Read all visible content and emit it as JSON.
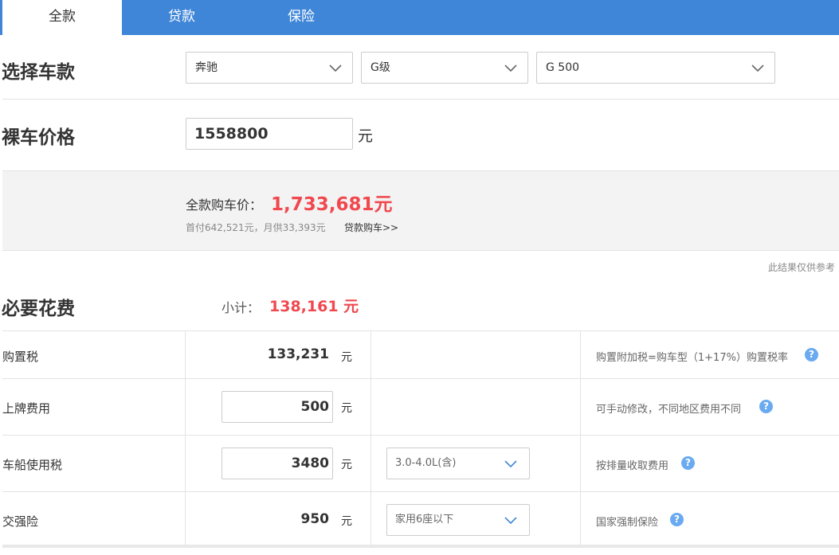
{
  "tabs": [
    {
      "label": "全款"
    },
    {
      "label": "贷款"
    },
    {
      "label": "保险"
    }
  ],
  "select_model": {
    "label": "选择车款",
    "brand": "奔驰",
    "series": "G级",
    "model": "G 500"
  },
  "price": {
    "label": "裸车价格",
    "value": "1558800",
    "unit": "元"
  },
  "summary": {
    "total_label": "全款购车价：",
    "total_value": "1,733,681元",
    "sub_text": "首付642,521元，月供33,393元",
    "loan_link": "贷款购车>>"
  },
  "note": "此结果仅供参考",
  "required": {
    "label": "必要花费",
    "subtotal_label": "小计：",
    "subtotal_value": "138,161 元",
    "rows": [
      {
        "label": "购置税",
        "value": "133,231",
        "unit": "元",
        "desc": "购置附加税=购车型（1+17%）购置税率"
      },
      {
        "label": "上牌费用",
        "value": "500",
        "unit": "元",
        "desc": "可手动修改，不同地区费用不同"
      },
      {
        "label": "车船使用税",
        "value": "3480",
        "unit": "元",
        "option": "3.0-4.0L(含)",
        "desc": "按排量收取费用"
      },
      {
        "label": "交强险",
        "value": "950",
        "unit": "元",
        "option": "家用6座以下",
        "desc": "国家强制保险"
      }
    ]
  },
  "colors": {
    "tab_bar": "#3f86d8",
    "accent_red": "#f0484e",
    "help_icon": "#6aaaf0"
  },
  "icons": {
    "dropdown": "chevron-down-icon",
    "help": "question-icon"
  }
}
